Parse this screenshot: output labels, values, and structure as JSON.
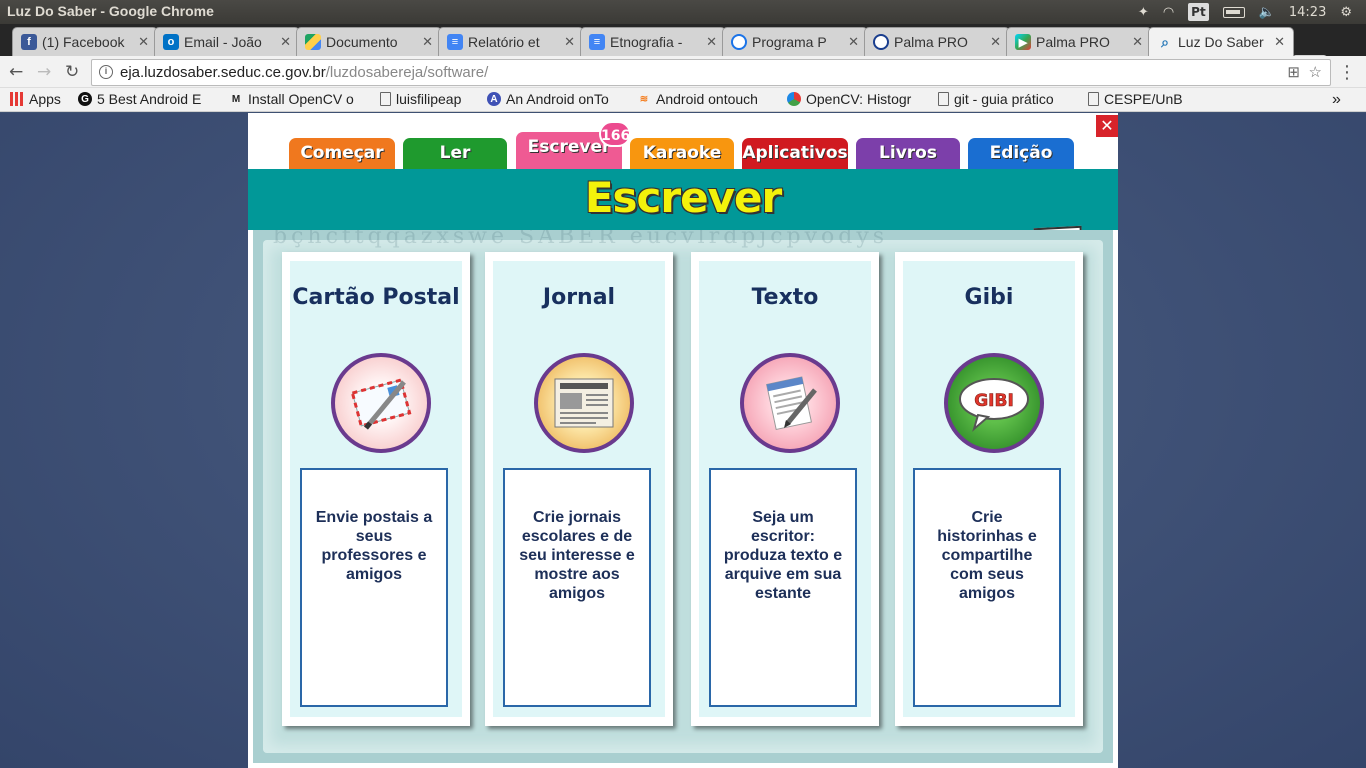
{
  "os": {
    "window_title": "Luz Do Saber - Google Chrome",
    "lang_indicator": "Pt",
    "clock": "14:23"
  },
  "browser": {
    "tabs": [
      {
        "label": "(1) Facebook",
        "icon": "facebook-icon",
        "color": "#3b5998"
      },
      {
        "label": "Email - João",
        "icon": "outlook-icon",
        "color": "#0072c6"
      },
      {
        "label": "Documento",
        "icon": "drive-icon",
        "color": "#1fa463"
      },
      {
        "label": "Relatório et",
        "icon": "docs-icon",
        "color": "#4285f4"
      },
      {
        "label": "Etnografia -",
        "icon": "docs-icon",
        "color": "#4285f4"
      },
      {
        "label": "Programa P",
        "icon": "loading-icon",
        "color": "#1a73e8"
      },
      {
        "label": "Palma PRO",
        "icon": "loading-icon",
        "color": "#1a3e8e"
      },
      {
        "label": "Palma PRO",
        "icon": "play-icon",
        "color": "#e53935"
      },
      {
        "label": "Luz Do Saber",
        "icon": "loading-icon",
        "color": "#2b7bb9",
        "active": true
      }
    ],
    "url_host": "eja.luzdosaber.seduc.ce.gov.br",
    "url_path": "/luzdosabereja/software/",
    "bookmarks": [
      {
        "label": "Apps",
        "icon": "apps-grid-icon"
      },
      {
        "label": "5 Best Android E",
        "icon": "g-circle-icon"
      },
      {
        "label": "Install OpenCV o",
        "icon": "m-logo-icon"
      },
      {
        "label": "luisfilipeap",
        "icon": "page-icon"
      },
      {
        "label": "An Android onTo",
        "icon": "a-circle-icon"
      },
      {
        "label": "Android ontouch",
        "icon": "stack-icon"
      },
      {
        "label": "OpenCV: Histogr",
        "icon": "opencv-icon"
      },
      {
        "label": "git - guia prático",
        "icon": "page-icon"
      },
      {
        "label": "CESPE/UnB",
        "icon": "page-icon"
      }
    ],
    "overflow": "»"
  },
  "app": {
    "nav_tabs": [
      {
        "label": "Começar",
        "color": "#f0781e"
      },
      {
        "label": "Ler",
        "color": "#1f9a2e"
      },
      {
        "label": "Escrever",
        "color": "#ef5a93",
        "active": true
      },
      {
        "label": "Karaoke",
        "color": "#f8960f"
      },
      {
        "label": "Aplicativos",
        "color": "#d01a20"
      },
      {
        "label": "Livros",
        "color": "#7c3faa"
      },
      {
        "label": "Edição",
        "color": "#1a6ed1"
      }
    ],
    "badge": "166",
    "close": "✕",
    "banner_title": "Escrever",
    "watermark_top": "bçhcttqqazxswe SABER eucvlrdpjcpvodys",
    "cards": [
      {
        "title": "Cartão Postal",
        "icon": "postcard-icon",
        "description": "Envie postais a seus professores e amigos"
      },
      {
        "title": "Jornal",
        "icon": "newspaper-icon",
        "description": "Crie jornais escolares e de seu interesse e mostre aos amigos"
      },
      {
        "title": "Texto",
        "icon": "document-pencil-icon",
        "description": "Seja um escritor: produza texto e arquive em sua estante"
      },
      {
        "title": "Gibi",
        "icon": "gibi-speech-bubble-icon",
        "gibi_text": "GIBI",
        "description": "Crie historinhas e compartilhe com seus amigos"
      }
    ]
  }
}
